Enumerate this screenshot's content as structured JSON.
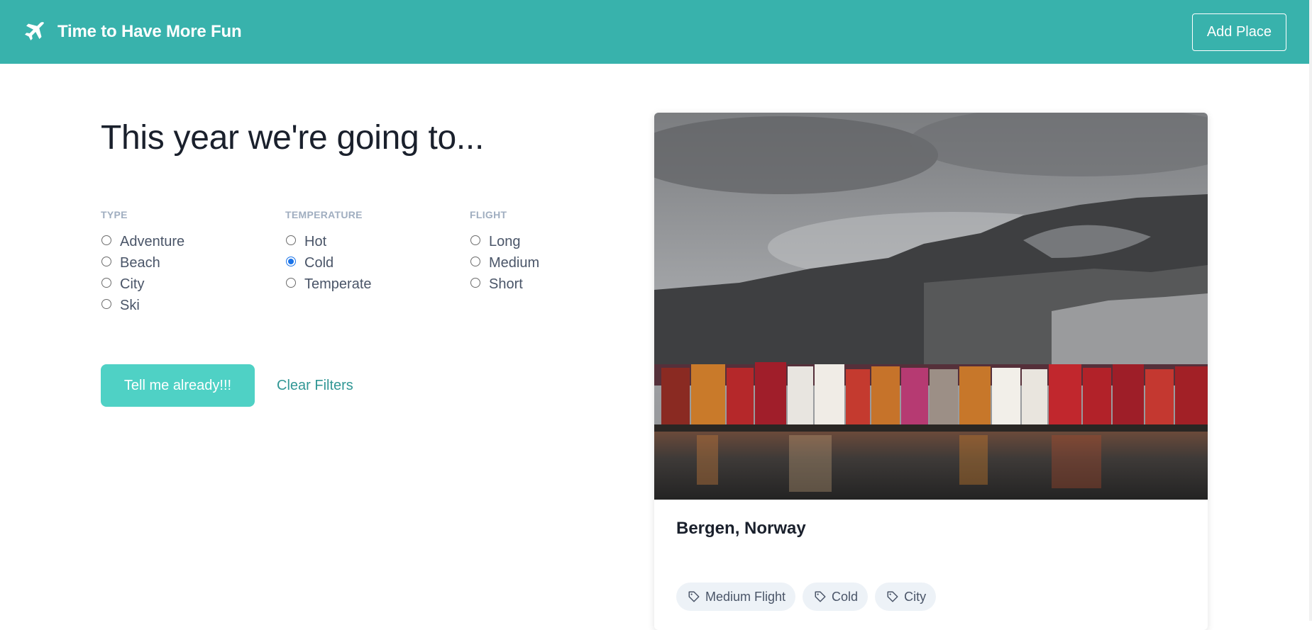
{
  "app": {
    "title": "Time to Have More Fun",
    "logo_icon": "airplane-icon",
    "brand_color": "#38b2ac"
  },
  "navbar": {
    "add_place_label": "Add Place"
  },
  "main": {
    "headline": "This year we're going to...",
    "filters": [
      {
        "label": "TYPE",
        "options": [
          {
            "label": "Adventure",
            "checked": false
          },
          {
            "label": "Beach",
            "checked": false
          },
          {
            "label": "City",
            "checked": false
          },
          {
            "label": "Ski",
            "checked": false
          }
        ]
      },
      {
        "label": "TEMPERATURE",
        "options": [
          {
            "label": "Hot",
            "checked": false
          },
          {
            "label": "Cold",
            "checked": true
          },
          {
            "label": "Temperate",
            "checked": false
          }
        ]
      },
      {
        "label": "FLIGHT",
        "options": [
          {
            "label": "Long",
            "checked": false
          },
          {
            "label": "Medium",
            "checked": false
          },
          {
            "label": "Short",
            "checked": false
          }
        ]
      }
    ],
    "submit_label": "Tell me already!!!",
    "clear_label": "Clear Filters"
  },
  "result": {
    "place_name": "Bergen, Norway",
    "tags": [
      {
        "label": "Medium Flight",
        "icon": "tag-icon"
      },
      {
        "label": "Cold",
        "icon": "tag-icon"
      },
      {
        "label": "City",
        "icon": "tag-icon"
      }
    ]
  }
}
